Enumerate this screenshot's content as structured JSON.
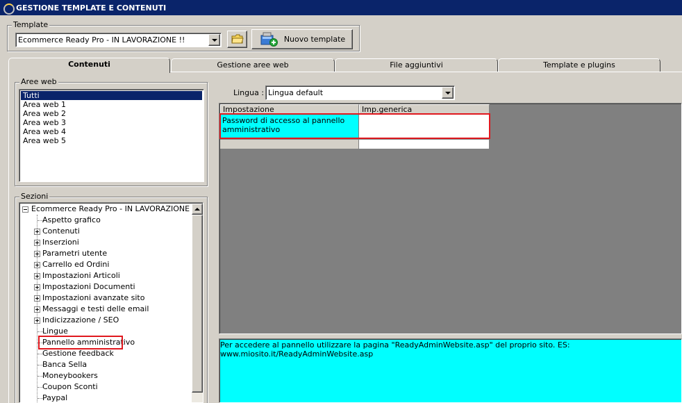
{
  "window": {
    "title": "GESTIONE TEMPLATE E CONTENUTI"
  },
  "template_group": {
    "label": "Template",
    "selected": "Ecommerce Ready Pro - IN LAVORAZIONE !!",
    "new_button": "Nuovo template"
  },
  "tabs": [
    {
      "label": "Contenuti",
      "active": true
    },
    {
      "label": "Gestione aree web",
      "active": false
    },
    {
      "label": "File aggiuntivi",
      "active": false
    },
    {
      "label": "Template e plugins",
      "active": false
    }
  ],
  "aree_web": {
    "label": "Aree web",
    "items": [
      "Tutti",
      "Area web 1",
      "Area web 2",
      "Area web 3",
      "Area web 4",
      "Area web 5"
    ],
    "selected_index": 0
  },
  "sezioni": {
    "label": "Sezioni",
    "root": "Ecommerce Ready Pro - IN LAVORAZIONE !!",
    "items": [
      {
        "label": "Aspetto grafico",
        "expandable": false
      },
      {
        "label": "Contenuti",
        "expandable": true
      },
      {
        "label": "Inserzioni",
        "expandable": true
      },
      {
        "label": "Parametri utente",
        "expandable": true
      },
      {
        "label": "Carrello ed Ordini",
        "expandable": true
      },
      {
        "label": "Impostazioni Articoli",
        "expandable": true
      },
      {
        "label": "Impostazioni Documenti",
        "expandable": true
      },
      {
        "label": "Impostazioni avanzate sito",
        "expandable": true
      },
      {
        "label": "Messaggi e testi delle email",
        "expandable": true
      },
      {
        "label": "Indicizzazione / SEO",
        "expandable": true
      },
      {
        "label": "Lingue",
        "expandable": false
      },
      {
        "label": "Pannello amministrativo",
        "expandable": false,
        "highlighted": true
      },
      {
        "label": "Gestione feedback",
        "expandable": false
      },
      {
        "label": "Banca Sella",
        "expandable": false
      },
      {
        "label": "Moneybookers",
        "expandable": false
      },
      {
        "label": "Coupon Sconti",
        "expandable": false
      },
      {
        "label": "Paypal",
        "expandable": false
      }
    ]
  },
  "lingua": {
    "label": "Lingua :",
    "selected": "Lingua default"
  },
  "grid": {
    "headers": [
      "Impostazione",
      "Imp.generica"
    ],
    "rows": [
      {
        "setting": "Password di accesso al pannello amministrativo",
        "value": ""
      }
    ]
  },
  "description": "Per accedere al pannello utilizzare la pagina \"ReadyAdminWebsite.asp\" del proprio sito. ES: www.miosito.it/ReadyAdminWebsite.asp",
  "colors": {
    "title_bar": "#0a246a",
    "highlight_cell": "#00ffff",
    "annotation_red": "#e0181e",
    "face": "#d4d0c8",
    "grid_background": "#808080"
  }
}
